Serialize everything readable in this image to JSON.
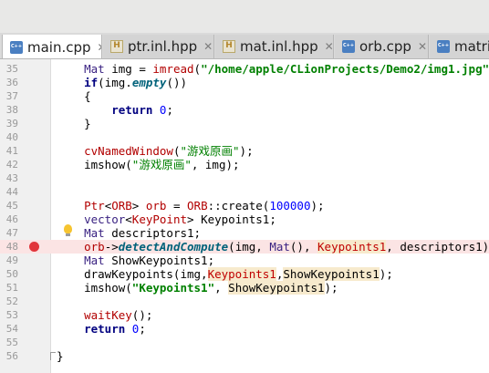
{
  "top_strip": {
    "glyphs": "            "
  },
  "tabs": [
    {
      "label": "main.cpp",
      "type": "cpp",
      "active": true,
      "close": "✕"
    },
    {
      "label": "ptr.inl.hpp",
      "type": "hpp",
      "active": false,
      "close": "✕"
    },
    {
      "label": "mat.inl.hpp",
      "type": "hpp",
      "active": false,
      "close": "✕"
    },
    {
      "label": "orb.cpp",
      "type": "cpp",
      "active": false,
      "close": "✕"
    },
    {
      "label": "matrix",
      "type": "cpp",
      "active": false,
      "close": ""
    }
  ],
  "editor": {
    "lines": [
      {
        "num": "35",
        "bp": false,
        "tokens": [
          {
            "t": "    "
          },
          {
            "t": "Mat",
            "c": "ty"
          },
          {
            "t": " img = "
          },
          {
            "t": "imread",
            "c": "mt"
          },
          {
            "t": "("
          },
          {
            "t": "\"/home/apple/CLionProjects/Demo2/img1.jpg\"",
            "c": "str"
          },
          {
            "t": ");"
          }
        ]
      },
      {
        "num": "36",
        "bp": false,
        "tokens": [
          {
            "t": "    "
          },
          {
            "t": "if",
            "c": "kw"
          },
          {
            "t": "(img."
          },
          {
            "t": "empty",
            "c": "fn"
          },
          {
            "t": "())"
          }
        ]
      },
      {
        "num": "37",
        "bp": false,
        "tokens": [
          {
            "t": "    {"
          }
        ]
      },
      {
        "num": "38",
        "bp": false,
        "tokens": [
          {
            "t": "        "
          },
          {
            "t": "return",
            "c": "kw"
          },
          {
            "t": " "
          },
          {
            "t": "0",
            "c": "num"
          },
          {
            "t": ";"
          }
        ]
      },
      {
        "num": "39",
        "bp": false,
        "tokens": [
          {
            "t": "    }"
          }
        ]
      },
      {
        "num": "40",
        "bp": false,
        "tokens": []
      },
      {
        "num": "41",
        "bp": false,
        "tokens": [
          {
            "t": "    "
          },
          {
            "t": "cvNamedWindow",
            "c": "mt"
          },
          {
            "t": "("
          },
          {
            "t": "\"游戏原画\"",
            "c": "str2"
          },
          {
            "t": ");"
          }
        ]
      },
      {
        "num": "42",
        "bp": false,
        "tokens": [
          {
            "t": "    imshow("
          },
          {
            "t": "\"游戏原画\"",
            "c": "str2"
          },
          {
            "t": ", img);"
          }
        ]
      },
      {
        "num": "43",
        "bp": false,
        "tokens": []
      },
      {
        "num": "44",
        "bp": false,
        "tokens": []
      },
      {
        "num": "45",
        "bp": false,
        "tokens": [
          {
            "t": "    "
          },
          {
            "t": "Ptr",
            "c": "mt"
          },
          {
            "t": "<"
          },
          {
            "t": "ORB",
            "c": "mt"
          },
          {
            "t": "> "
          },
          {
            "t": "orb",
            "c": "mt"
          },
          {
            "t": " = "
          },
          {
            "t": "ORB",
            "c": "mt"
          },
          {
            "t": "::create("
          },
          {
            "t": "100000",
            "c": "num"
          },
          {
            "t": ");"
          }
        ]
      },
      {
        "num": "46",
        "bp": false,
        "tokens": [
          {
            "t": "    "
          },
          {
            "t": "vector",
            "c": "ty"
          },
          {
            "t": "<"
          },
          {
            "t": "KeyPoint",
            "c": "mt"
          },
          {
            "t": "> Keypoints1;"
          }
        ]
      },
      {
        "num": "47",
        "bp": false,
        "bulb": true,
        "tokens": [
          {
            "t": "    "
          },
          {
            "t": "Mat",
            "c": "ty"
          },
          {
            "t": " descriptors1;"
          }
        ]
      },
      {
        "num": "48",
        "bp": true,
        "tokens": [
          {
            "t": "    "
          },
          {
            "t": "orb",
            "c": "mt"
          },
          {
            "t": "->"
          },
          {
            "t": "detectAndCompute",
            "c": "fn"
          },
          {
            "t": "(img, "
          },
          {
            "t": "Mat",
            "c": "ty"
          },
          {
            "t": "(), "
          },
          {
            "t": "Keypoints1",
            "c": "var-red var-mark"
          },
          {
            "t": ", descriptors1);"
          }
        ]
      },
      {
        "num": "49",
        "bp": false,
        "tokens": [
          {
            "t": "    "
          },
          {
            "t": "Mat",
            "c": "ty"
          },
          {
            "t": " ShowKeypoints1;"
          }
        ]
      },
      {
        "num": "50",
        "bp": false,
        "tokens": [
          {
            "t": "    drawKeypoints(img,"
          },
          {
            "t": "Keypoints1",
            "c": "var-red var-mark"
          },
          {
            "t": ","
          },
          {
            "t": "ShowKeypoints1",
            "c": "var-mark"
          },
          {
            "t": ");"
          }
        ]
      },
      {
        "num": "51",
        "bp": false,
        "tokens": [
          {
            "t": "    imshow("
          },
          {
            "t": "\"Keypoints1\"",
            "c": "str"
          },
          {
            "t": ", "
          },
          {
            "t": "ShowKeypoints1",
            "c": "var-mark"
          },
          {
            "t": ");"
          }
        ]
      },
      {
        "num": "52",
        "bp": false,
        "tokens": []
      },
      {
        "num": "53",
        "bp": false,
        "tokens": [
          {
            "t": "    "
          },
          {
            "t": "waitKey",
            "c": "mt"
          },
          {
            "t": "();"
          }
        ]
      },
      {
        "num": "54",
        "bp": false,
        "tokens": [
          {
            "t": "    "
          },
          {
            "t": "return",
            "c": "kw"
          },
          {
            "t": " "
          },
          {
            "t": "0",
            "c": "num"
          },
          {
            "t": ";"
          }
        ]
      },
      {
        "num": "55",
        "bp": false,
        "tokens": []
      },
      {
        "num": "56",
        "bp": false,
        "fold": true,
        "tokens": [
          {
            "t": "}"
          }
        ]
      }
    ]
  }
}
